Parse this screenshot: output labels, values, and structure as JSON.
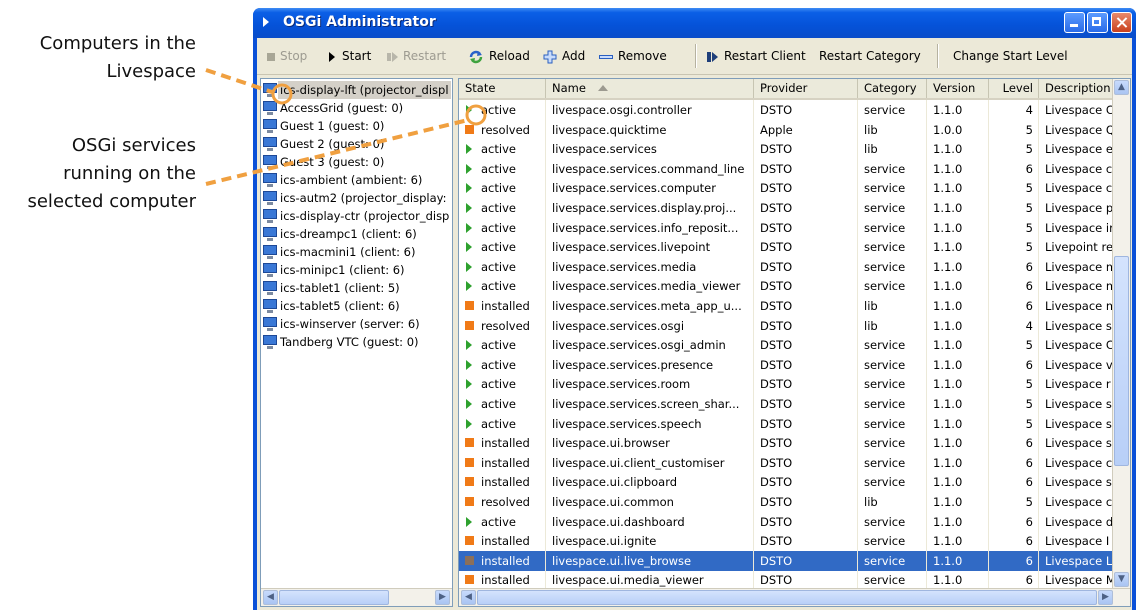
{
  "annotations": {
    "computers": [
      "Computers in the",
      "Livespace"
    ],
    "services": [
      "OSGi services",
      "running on the",
      "selected computer"
    ],
    "color": "#f0a040"
  },
  "window": {
    "title": "OSGi Administrator",
    "titlebar_color": "#0552d8"
  },
  "toolbar": {
    "stop": "Stop",
    "start": "Start",
    "restart": "Restart",
    "reload": "Reload",
    "add": "Add",
    "remove": "Remove",
    "restart_client": "Restart Client",
    "restart_category": "Restart Category",
    "change_start_level": "Change Start Level"
  },
  "computers": [
    {
      "label": "ics-display-lft (projector_displ"
    },
    {
      "label": "AccessGrid (guest: 0)"
    },
    {
      "label": "Guest 1 (guest: 0)"
    },
    {
      "label": "Guest 2 (guest: 0)"
    },
    {
      "label": "Guest 3 (guest: 0)"
    },
    {
      "label": "ics-ambient (ambient: 6)"
    },
    {
      "label": "ics-autm2 (projector_display:"
    },
    {
      "label": "ics-display-ctr (projector_disp"
    },
    {
      "label": "ics-dreampc1 (client: 6)"
    },
    {
      "label": "ics-macmini1 (client: 6)"
    },
    {
      "label": "ics-minipc1 (client: 6)"
    },
    {
      "label": "ics-tablet1 (client: 5)"
    },
    {
      "label": "ics-tablet5 (client: 6)"
    },
    {
      "label": "ics-winserver (server: 6)"
    },
    {
      "label": "Tandberg VTC (guest: 0)"
    }
  ],
  "selected_computer_index": 0,
  "table": {
    "headers": {
      "state": "State",
      "name": "Name",
      "provider": "Provider",
      "category": "Category",
      "version": "Version",
      "level": "Level",
      "description": "Description"
    },
    "status_colors": {
      "active": "#2ea12e",
      "resolved": "#f07a17",
      "installed": "#f07a17"
    },
    "rows": [
      {
        "state": "active",
        "name": "livespace.osgi.controller",
        "provider": "DSTO",
        "category": "service",
        "version": "1.1.0",
        "level": "4",
        "description": "Livespace C"
      },
      {
        "state": "resolved",
        "name": "livespace.quicktime",
        "provider": "Apple",
        "category": "lib",
        "version": "1.0.0",
        "level": "5",
        "description": "Livespace Q"
      },
      {
        "state": "active",
        "name": "livespace.services",
        "provider": "DSTO",
        "category": "lib",
        "version": "1.1.0",
        "level": "5",
        "description": "Livespace e"
      },
      {
        "state": "active",
        "name": "livespace.services.command_line",
        "provider": "DSTO",
        "category": "service",
        "version": "1.1.0",
        "level": "6",
        "description": "Livespace c"
      },
      {
        "state": "active",
        "name": "livespace.services.computer",
        "provider": "DSTO",
        "category": "service",
        "version": "1.1.0",
        "level": "5",
        "description": "Livespace c"
      },
      {
        "state": "active",
        "name": "livespace.services.display.proj...",
        "provider": "DSTO",
        "category": "service",
        "version": "1.1.0",
        "level": "5",
        "description": "Livespace p"
      },
      {
        "state": "active",
        "name": "livespace.services.info_reposit...",
        "provider": "DSTO",
        "category": "service",
        "version": "1.1.0",
        "level": "5",
        "description": "Livespace ir"
      },
      {
        "state": "active",
        "name": "livespace.services.livepoint",
        "provider": "DSTO",
        "category": "service",
        "version": "1.1.0",
        "level": "5",
        "description": "Livepoint re"
      },
      {
        "state": "active",
        "name": "livespace.services.media",
        "provider": "DSTO",
        "category": "service",
        "version": "1.1.0",
        "level": "6",
        "description": "Livespace m"
      },
      {
        "state": "active",
        "name": "livespace.services.media_viewer",
        "provider": "DSTO",
        "category": "service",
        "version": "1.1.0",
        "level": "6",
        "description": "Livespace m"
      },
      {
        "state": "installed",
        "name": "livespace.services.meta_app_u...",
        "provider": "DSTO",
        "category": "lib",
        "version": "1.1.0",
        "level": "6",
        "description": "Livespace m"
      },
      {
        "state": "resolved",
        "name": "livespace.services.osgi",
        "provider": "DSTO",
        "category": "lib",
        "version": "1.1.0",
        "level": "4",
        "description": "Livespace s"
      },
      {
        "state": "active",
        "name": "livespace.services.osgi_admin",
        "provider": "DSTO",
        "category": "service",
        "version": "1.1.0",
        "level": "5",
        "description": "Livespace C"
      },
      {
        "state": "active",
        "name": "livespace.services.presence",
        "provider": "DSTO",
        "category": "service",
        "version": "1.1.0",
        "level": "6",
        "description": "Livespace v"
      },
      {
        "state": "active",
        "name": "livespace.services.room",
        "provider": "DSTO",
        "category": "service",
        "version": "1.1.0",
        "level": "5",
        "description": "Livespace r"
      },
      {
        "state": "active",
        "name": "livespace.services.screen_shar...",
        "provider": "DSTO",
        "category": "service",
        "version": "1.1.0",
        "level": "5",
        "description": "Livespace s"
      },
      {
        "state": "active",
        "name": "livespace.services.speech",
        "provider": "DSTO",
        "category": "service",
        "version": "1.1.0",
        "level": "5",
        "description": "Livespace s"
      },
      {
        "state": "installed",
        "name": "livespace.ui.browser",
        "provider": "DSTO",
        "category": "service",
        "version": "1.1.0",
        "level": "6",
        "description": "Livespace s"
      },
      {
        "state": "installed",
        "name": "livespace.ui.client_customiser",
        "provider": "DSTO",
        "category": "service",
        "version": "1.1.0",
        "level": "6",
        "description": "Livespace c"
      },
      {
        "state": "installed",
        "name": "livespace.ui.clipboard",
        "provider": "DSTO",
        "category": "service",
        "version": "1.1.0",
        "level": "6",
        "description": "Livespace s"
      },
      {
        "state": "resolved",
        "name": "livespace.ui.common",
        "provider": "DSTO",
        "category": "lib",
        "version": "1.1.0",
        "level": "5",
        "description": "Livespace c"
      },
      {
        "state": "active",
        "name": "livespace.ui.dashboard",
        "provider": "DSTO",
        "category": "service",
        "version": "1.1.0",
        "level": "6",
        "description": "Livespace d"
      },
      {
        "state": "installed",
        "name": "livespace.ui.ignite",
        "provider": "DSTO",
        "category": "service",
        "version": "1.1.0",
        "level": "6",
        "description": "Livespace I"
      },
      {
        "state": "installed",
        "name": "livespace.ui.live_browse",
        "provider": "DSTO",
        "category": "service",
        "version": "1.1.0",
        "level": "6",
        "description": "Livespace L"
      },
      {
        "state": "installed",
        "name": "livespace.ui.media_viewer",
        "provider": "DSTO",
        "category": "service",
        "version": "1.1.0",
        "level": "6",
        "description": "Livespace M"
      }
    ],
    "selected_row_index": 23
  }
}
